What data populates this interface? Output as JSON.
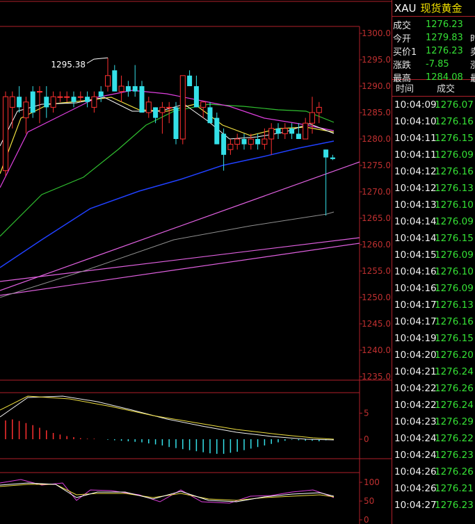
{
  "header": {
    "symbol": "XAU",
    "name": "现货黄金"
  },
  "quote": [
    {
      "label": "成交",
      "value": "1276.23",
      "extra": ""
    },
    {
      "label": "今开",
      "value": "1279.83",
      "extra": "时"
    },
    {
      "label": "买价1",
      "value": "1276.23",
      "extra": "卖"
    },
    {
      "label": "涨跌",
      "value": "-7.85",
      "extra": "涨"
    },
    {
      "label": "最高",
      "value": "1284.08",
      "extra": "最"
    }
  ],
  "ticks_header": {
    "time": "时间",
    "price": "成交"
  },
  "ticks": [
    {
      "time": "10:04:09",
      "price": "1276.07"
    },
    {
      "time": "10:04:10",
      "price": "1276.16"
    },
    {
      "time": "10:04:11",
      "price": "1276.15"
    },
    {
      "time": "10:04:11",
      "price": "1276.09"
    },
    {
      "time": "10:04:12",
      "price": "1276.16"
    },
    {
      "time": "10:04:12",
      "price": "1276.13"
    },
    {
      "time": "10:04:13",
      "price": "1276.10"
    },
    {
      "time": "10:04:14",
      "price": "1276.09"
    },
    {
      "time": "10:04:14",
      "price": "1276.15"
    },
    {
      "time": "10:04:15",
      "price": "1276.09"
    },
    {
      "time": "10:04:16",
      "price": "1276.10"
    },
    {
      "time": "10:04:16",
      "price": "1276.09"
    },
    {
      "time": "10:04:17",
      "price": "1276.13"
    },
    {
      "time": "10:04:17",
      "price": "1276.16"
    },
    {
      "time": "10:04:19",
      "price": "1276.15"
    },
    {
      "time": "10:04:20",
      "price": "1276.20"
    },
    {
      "time": "10:04:21",
      "price": "1276.24"
    },
    {
      "time": "10:04:22",
      "price": "1276.26"
    },
    {
      "time": "10:04:22",
      "price": "1276.24"
    },
    {
      "time": "10:04:23",
      "price": "1276.29"
    },
    {
      "time": "10:04:24",
      "price": "1276.22"
    },
    {
      "time": "10:04:24",
      "price": "1276.23"
    },
    {
      "time": "10:04:26",
      "price": "1276.26"
    },
    {
      "time": "10:04:26",
      "price": "1276.21"
    },
    {
      "time": "10:04:27",
      "price": "1276.23"
    }
  ],
  "colors": {
    "up": "#ff3030",
    "down": "#34e0e8",
    "grid": "#b0202a",
    "axis_text": "#c03030",
    "accent": "#f2e200"
  },
  "chart_data": [
    {
      "type": "candlestick",
      "y_ticks": [
        "1300.0",
        "1295.0",
        "1290.0",
        "1285.0",
        "1280.0",
        "1275.0",
        "1270.0",
        "1265.0",
        "1260.0",
        "1255.0",
        "1250.0",
        "1245.0",
        "1240.0",
        "1235.0"
      ],
      "ylim": [
        1235.0,
        1301.0
      ],
      "annotation": {
        "label": "1295.38",
        "value": 1295.38
      },
      "candles": [
        {
          "o": 1274,
          "h": 1289,
          "l": 1273,
          "c": 1288
        },
        {
          "o": 1286,
          "h": 1289,
          "l": 1282,
          "c": 1288
        },
        {
          "o": 1288,
          "h": 1290,
          "l": 1285,
          "c": 1286
        },
        {
          "o": 1284,
          "h": 1288,
          "l": 1281,
          "c": 1287
        },
        {
          "o": 1289,
          "h": 1290,
          "l": 1284,
          "c": 1285
        },
        {
          "o": 1289,
          "h": 1290,
          "l": 1283,
          "c": 1289
        },
        {
          "o": 1288,
          "h": 1290,
          "l": 1284,
          "c": 1286
        },
        {
          "o": 1286,
          "h": 1289,
          "l": 1285,
          "c": 1288
        },
        {
          "o": 1288,
          "h": 1289,
          "l": 1287,
          "c": 1288
        },
        {
          "o": 1288,
          "h": 1289,
          "l": 1287,
          "c": 1288
        },
        {
          "o": 1288,
          "h": 1289,
          "l": 1286,
          "c": 1287
        },
        {
          "o": 1288,
          "h": 1289,
          "l": 1287,
          "c": 1288
        },
        {
          "o": 1288,
          "h": 1289,
          "l": 1286,
          "c": 1287
        },
        {
          "o": 1286,
          "h": 1289,
          "l": 1285,
          "c": 1288
        },
        {
          "o": 1289,
          "h": 1290,
          "l": 1287,
          "c": 1288
        },
        {
          "o": 1290,
          "h": 1295.38,
          "l": 1289,
          "c": 1292
        },
        {
          "o": 1293,
          "h": 1294,
          "l": 1289,
          "c": 1289
        },
        {
          "o": 1289,
          "h": 1292,
          "l": 1287,
          "c": 1290
        },
        {
          "o": 1290,
          "h": 1291,
          "l": 1288,
          "c": 1289
        },
        {
          "o": 1290,
          "h": 1294,
          "l": 1288,
          "c": 1289
        },
        {
          "o": 1290,
          "h": 1291,
          "l": 1285,
          "c": 1285
        },
        {
          "o": 1285,
          "h": 1288,
          "l": 1284,
          "c": 1287
        },
        {
          "o": 1286,
          "h": 1286,
          "l": 1283,
          "c": 1284
        },
        {
          "o": 1285,
          "h": 1287,
          "l": 1281,
          "c": 1286
        },
        {
          "o": 1286,
          "h": 1287,
          "l": 1283,
          "c": 1286
        },
        {
          "o": 1286,
          "h": 1287,
          "l": 1279,
          "c": 1280
        },
        {
          "o": 1280,
          "h": 1290,
          "l": 1279,
          "c": 1292
        },
        {
          "o": 1292,
          "h": 1293,
          "l": 1290,
          "c": 1290
        },
        {
          "o": 1290,
          "h": 1292,
          "l": 1286,
          "c": 1286
        },
        {
          "o": 1286,
          "h": 1287,
          "l": 1284,
          "c": 1287
        },
        {
          "o": 1286,
          "h": 1287,
          "l": 1283,
          "c": 1283
        },
        {
          "o": 1284,
          "h": 1285,
          "l": 1279,
          "c": 1279
        },
        {
          "o": 1281,
          "h": 1282,
          "l": 1274,
          "c": 1277
        },
        {
          "o": 1278,
          "h": 1280,
          "l": 1277,
          "c": 1279
        },
        {
          "o": 1279,
          "h": 1281,
          "l": 1278,
          "c": 1280
        },
        {
          "o": 1280,
          "h": 1281,
          "l": 1278,
          "c": 1279
        },
        {
          "o": 1279,
          "h": 1281,
          "l": 1278,
          "c": 1280
        },
        {
          "o": 1280,
          "h": 1281,
          "l": 1278,
          "c": 1279
        },
        {
          "o": 1279,
          "h": 1282,
          "l": 1278,
          "c": 1280
        },
        {
          "o": 1280,
          "h": 1283,
          "l": 1277,
          "c": 1282
        },
        {
          "o": 1282,
          "h": 1283,
          "l": 1280,
          "c": 1281
        },
        {
          "o": 1281,
          "h": 1283,
          "l": 1280,
          "c": 1282
        },
        {
          "o": 1282,
          "h": 1283,
          "l": 1280,
          "c": 1281
        },
        {
          "o": 1281,
          "h": 1283,
          "l": 1280,
          "c": 1280
        },
        {
          "o": 1280,
          "h": 1284,
          "l": 1280,
          "c": 1283
        },
        {
          "o": 1283,
          "h": 1288,
          "l": 1281,
          "c": 1285
        },
        {
          "o": 1285,
          "h": 1287,
          "l": 1283,
          "c": 1286
        },
        {
          "o": 1278,
          "h": 1278,
          "l": 1265.5,
          "c": 1276.5
        },
        {
          "o": 1276.5,
          "h": 1277,
          "l": 1276,
          "c": 1276.2
        }
      ]
    },
    {
      "type": "bar",
      "y_ticks": [
        "5",
        "0"
      ],
      "ylim": [
        -3.5,
        9
      ],
      "values": [
        3.6,
        3.8,
        3.5,
        3.1,
        2.7,
        2.2,
        1.7,
        1.2,
        0.9,
        0.6,
        0.4,
        0.2,
        0.1,
        0.1,
        0,
        -0.1,
        -0.2,
        -0.3,
        -0.4,
        -0.5,
        -0.6,
        -0.8,
        -1,
        -1.2,
        -1.5,
        -1.7,
        -1.9,
        -2.1,
        -2.3,
        -2.5,
        -2.7,
        -2.8,
        -2.8,
        -2.6,
        -2.4,
        -2.1,
        -1.8,
        -1.5,
        -1.2,
        -0.9,
        -0.6,
        -0.3,
        -0.1,
        -0.2,
        -0.3,
        -0.3,
        -0.4,
        -0.2,
        -0.1
      ]
    },
    {
      "type": "line",
      "y_ticks": [
        "100",
        "50",
        "0"
      ],
      "ylim": [
        0,
        110
      ]
    }
  ]
}
